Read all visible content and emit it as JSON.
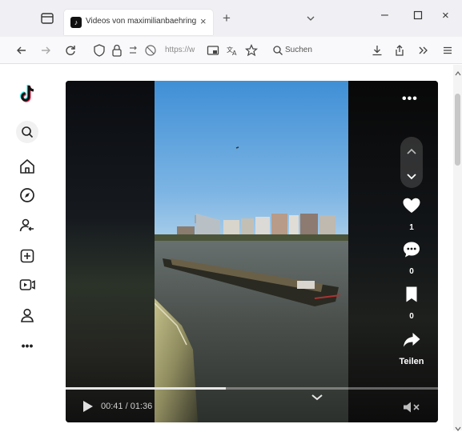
{
  "browser": {
    "tab": {
      "title": "Videos von maximilianbaehring",
      "favicon": "tiktok-icon"
    },
    "new_tab_label": "+",
    "close_glyph": "×",
    "window": {
      "minimize": "–",
      "close": "×"
    },
    "url": "https://w",
    "search_placeholder": "Suchen"
  },
  "sidebar": {
    "items": [
      {
        "icon": "tiktok-logo"
      },
      {
        "icon": "search-icon"
      },
      {
        "icon": "home-icon"
      },
      {
        "icon": "compass-icon"
      },
      {
        "icon": "following-icon"
      },
      {
        "icon": "upload-icon"
      },
      {
        "icon": "live-icon"
      },
      {
        "icon": "profile-icon"
      },
      {
        "icon": "more-icon",
        "label": "•••"
      }
    ]
  },
  "video": {
    "more_label": "•••",
    "likes": "1",
    "comments": "0",
    "saves": "0",
    "share_label": "Teilen",
    "time": "00:41 / 01:36",
    "progress": 0.43
  },
  "colors": {
    "accent": "#fe2c55",
    "tab_bar": "#f0f0f4",
    "nav_bar": "#f9f9fb"
  }
}
